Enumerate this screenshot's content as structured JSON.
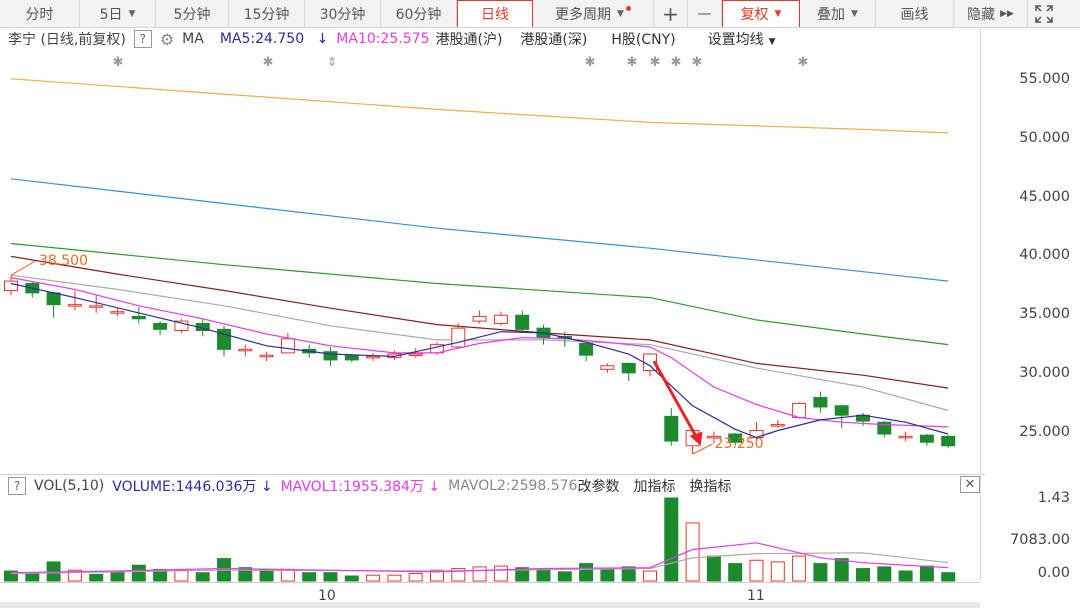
{
  "toolbar": {
    "items": [
      "分时",
      "5日",
      "5分钟",
      "15分钟",
      "30分钟",
      "60分钟",
      "日线",
      "更多周期",
      "+",
      "—",
      "复权",
      "叠加",
      "画线",
      "隐藏"
    ],
    "fullscreen_icon": "expand-icon"
  },
  "info": {
    "stock": "李宁 (日线,前复权)",
    "help": "?",
    "ma_label": "MA",
    "ma5": "MA5:24.750",
    "ma5_arrow": "↓",
    "ma10": "MA10:25.575",
    "hk_sh": "港股通(沪)",
    "hk_sz": "港股通(深)",
    "hshare": "H股(CNY)",
    "set_ma": "设置均线"
  },
  "price_axis": [
    "55.000",
    "50.000",
    "45.000",
    "40.000",
    "35.000",
    "30.000",
    "25.000"
  ],
  "annotations": {
    "high": "38.500",
    "low": "23.250"
  },
  "volume": {
    "help": "?",
    "label": "VOL(5,10)",
    "volume": "VOLUME:1446.036万",
    "vol_arrow": "↓",
    "mavol1": "MAVOL1:1955.384万",
    "mavol1_arrow": "↓",
    "mavol2": "MAVOL2:2598.576",
    "change_params": "改参数",
    "add_indicator": "加指标",
    "switch_indicator": "换指标",
    "close": "✕",
    "axis": [
      "1.43",
      "7083.00",
      "0.00"
    ]
  },
  "dates": [
    "10",
    "11"
  ],
  "colors": {
    "up": "#e8382a",
    "down": "#1e8a2e",
    "ma5": "#2c2c9e",
    "ma10": "#e83ae8",
    "ma20": "#aaaaaa",
    "ma30": "#8b2020",
    "ma60": "#2e9b2e",
    "ma120": "#3a8fd8",
    "ma250": "#f0b040"
  },
  "chart_data": {
    "type": "candlestick",
    "ylim": [
      22.6,
      58
    ],
    "candles": [
      {
        "o": 37.2,
        "c": 38.0,
        "h": 38.5,
        "l": 36.8
      },
      {
        "o": 37.8,
        "c": 37.0,
        "h": 38.0,
        "l": 36.6
      },
      {
        "o": 37.0,
        "c": 36.0,
        "h": 37.1,
        "l": 34.9
      },
      {
        "o": 36.0,
        "c": 36.0,
        "h": 37.2,
        "l": 35.5
      },
      {
        "o": 35.9,
        "c": 35.9,
        "h": 36.8,
        "l": 35.3
      },
      {
        "o": 35.4,
        "c": 35.4,
        "h": 35.7,
        "l": 35.0
      },
      {
        "o": 35.0,
        "c": 34.8,
        "h": 35.8,
        "l": 34.4
      },
      {
        "o": 34.4,
        "c": 33.9,
        "h": 34.6,
        "l": 33.4
      },
      {
        "o": 33.8,
        "c": 34.6,
        "h": 34.8,
        "l": 33.6
      },
      {
        "o": 34.4,
        "c": 33.8,
        "h": 34.8,
        "l": 33.3
      },
      {
        "o": 33.9,
        "c": 32.2,
        "h": 34.2,
        "l": 31.6
      },
      {
        "o": 32.2,
        "c": 32.2,
        "h": 32.6,
        "l": 31.6
      },
      {
        "o": 31.7,
        "c": 31.7,
        "h": 32.0,
        "l": 31.2
      },
      {
        "o": 31.9,
        "c": 33.1,
        "h": 33.6,
        "l": 31.9
      },
      {
        "o": 32.2,
        "c": 31.9,
        "h": 32.6,
        "l": 31.5
      },
      {
        "o": 32.0,
        "c": 31.3,
        "h": 32.4,
        "l": 30.8
      },
      {
        "o": 31.7,
        "c": 31.3,
        "h": 31.8,
        "l": 31.1
      },
      {
        "o": 31.6,
        "c": 31.6,
        "h": 31.9,
        "l": 31.2
      },
      {
        "o": 31.5,
        "c": 31.8,
        "h": 32.1,
        "l": 31.3
      },
      {
        "o": 31.8,
        "c": 31.8,
        "h": 32.3,
        "l": 31.5
      },
      {
        "o": 31.9,
        "c": 32.6,
        "h": 32.8,
        "l": 31.7
      },
      {
        "o": 32.4,
        "c": 34.0,
        "h": 34.4,
        "l": 32.3
      },
      {
        "o": 34.6,
        "c": 35.0,
        "h": 35.5,
        "l": 34.4
      },
      {
        "o": 34.4,
        "c": 35.1,
        "h": 35.4,
        "l": 34.2
      },
      {
        "o": 35.1,
        "c": 33.9,
        "h": 35.5,
        "l": 33.6
      },
      {
        "o": 34.0,
        "c": 33.2,
        "h": 34.3,
        "l": 32.6
      },
      {
        "o": 33.3,
        "c": 33.1,
        "h": 33.7,
        "l": 32.4
      },
      {
        "o": 32.7,
        "c": 31.7,
        "h": 32.8,
        "l": 31.2
      },
      {
        "o": 30.5,
        "c": 30.8,
        "h": 31.0,
        "l": 30.2
      },
      {
        "o": 31.0,
        "c": 30.2,
        "h": 31.1,
        "l": 29.5
      },
      {
        "o": 30.4,
        "c": 31.8,
        "h": 31.9,
        "l": 29.9
      },
      {
        "o": 26.5,
        "c": 24.4,
        "h": 27.2,
        "l": 24.0
      },
      {
        "o": 24.0,
        "c": 25.3,
        "h": 25.4,
        "l": 23.3
      },
      {
        "o": 24.8,
        "c": 24.8,
        "h": 25.2,
        "l": 24.2
      },
      {
        "o": 25.0,
        "c": 24.3,
        "h": 25.1,
        "l": 24.0
      },
      {
        "o": 24.7,
        "c": 25.3,
        "h": 26.0,
        "l": 24.5
      },
      {
        "o": 25.8,
        "c": 25.8,
        "h": 26.2,
        "l": 25.5
      },
      {
        "o": 26.4,
        "c": 27.6,
        "h": 27.7,
        "l": 26.3
      },
      {
        "o": 28.1,
        "c": 27.3,
        "h": 28.6,
        "l": 26.8
      },
      {
        "o": 27.4,
        "c": 26.6,
        "h": 27.5,
        "l": 25.5
      },
      {
        "o": 26.6,
        "c": 26.1,
        "h": 26.8,
        "l": 25.7
      },
      {
        "o": 26.0,
        "c": 25.0,
        "h": 26.1,
        "l": 24.7
      },
      {
        "o": 24.8,
        "c": 24.8,
        "h": 25.2,
        "l": 24.4
      },
      {
        "o": 24.9,
        "c": 24.3,
        "h": 25.0,
        "l": 24.0
      },
      {
        "o": 24.8,
        "c": 24.0,
        "h": 24.9,
        "l": 23.8
      }
    ],
    "ma5": [
      [
        0,
        37.8
      ],
      [
        3,
        36.6
      ],
      [
        6,
        35.3
      ],
      [
        9,
        34.0
      ],
      [
        12,
        32.5
      ],
      [
        15,
        31.8
      ],
      [
        18,
        31.6
      ],
      [
        21,
        32.8
      ],
      [
        23,
        33.7
      ],
      [
        25,
        33.6
      ],
      [
        27,
        32.8
      ],
      [
        29,
        31.8
      ],
      [
        30,
        30.8
      ],
      [
        32,
        27.4
      ],
      [
        34,
        25.4
      ],
      [
        35,
        24.7
      ],
      [
        36,
        25.3
      ],
      [
        38,
        26.2
      ],
      [
        40,
        26.6
      ],
      [
        42,
        26.0
      ],
      [
        44,
        25.0
      ]
    ],
    "ma10": [
      [
        0,
        38.3
      ],
      [
        3,
        37.3
      ],
      [
        6,
        35.9
      ],
      [
        9,
        34.8
      ],
      [
        12,
        33.5
      ],
      [
        15,
        32.5
      ],
      [
        18,
        31.9
      ],
      [
        20,
        31.9
      ],
      [
        22,
        32.7
      ],
      [
        24,
        33.2
      ],
      [
        26,
        33.1
      ],
      [
        28,
        32.8
      ],
      [
        30,
        32.4
      ],
      [
        31,
        31.5
      ],
      [
        33,
        29.0
      ],
      [
        35,
        27.5
      ],
      [
        37,
        26.4
      ],
      [
        39,
        26.0
      ],
      [
        41,
        25.8
      ],
      [
        44,
        25.6
      ]
    ],
    "ma20": [
      [
        0,
        38.5
      ],
      [
        5,
        37.3
      ],
      [
        10,
        35.9
      ],
      [
        15,
        34.2
      ],
      [
        20,
        33.0
      ],
      [
        25,
        33.0
      ],
      [
        30,
        32.6
      ],
      [
        35,
        30.6
      ],
      [
        40,
        29.0
      ],
      [
        44,
        27.0
      ]
    ],
    "ma30": [
      [
        0,
        40.1
      ],
      [
        5,
        38.6
      ],
      [
        10,
        37.2
      ],
      [
        15,
        35.7
      ],
      [
        20,
        34.3
      ],
      [
        25,
        33.6
      ],
      [
        30,
        33.0
      ],
      [
        35,
        31.0
      ],
      [
        40,
        30.0
      ],
      [
        44,
        28.9
      ]
    ],
    "ma60": [
      [
        0,
        41.2
      ],
      [
        10,
        39.4
      ],
      [
        20,
        37.8
      ],
      [
        30,
        36.6
      ],
      [
        35,
        34.7
      ],
      [
        40,
        33.5
      ],
      [
        44,
        32.6
      ]
    ],
    "ma120": [
      [
        0,
        46.7
      ],
      [
        10,
        44.6
      ],
      [
        20,
        42.5
      ],
      [
        30,
        40.8
      ],
      [
        40,
        38.8
      ],
      [
        44,
        38.0
      ]
    ],
    "ma250": [
      [
        0,
        55.2
      ],
      [
        10,
        53.9
      ],
      [
        20,
        52.6
      ],
      [
        30,
        51.5
      ],
      [
        40,
        50.9
      ],
      [
        44,
        50.6
      ]
    ],
    "volume": [
      {
        "v": 0.12,
        "up": false
      },
      {
        "v": 0.1,
        "up": false
      },
      {
        "v": 0.23,
        "up": false
      },
      {
        "v": 0.13,
        "up": true
      },
      {
        "v": 0.08,
        "up": false
      },
      {
        "v": 0.11,
        "up": false
      },
      {
        "v": 0.19,
        "up": false
      },
      {
        "v": 0.14,
        "up": false
      },
      {
        "v": 0.13,
        "up": true
      },
      {
        "v": 0.1,
        "up": false
      },
      {
        "v": 0.27,
        "up": false
      },
      {
        "v": 0.16,
        "up": false
      },
      {
        "v": 0.14,
        "up": false
      },
      {
        "v": 0.14,
        "up": true
      },
      {
        "v": 0.1,
        "up": false
      },
      {
        "v": 0.1,
        "up": false
      },
      {
        "v": 0.06,
        "up": false
      },
      {
        "v": 0.07,
        "up": true
      },
      {
        "v": 0.07,
        "up": true
      },
      {
        "v": 0.09,
        "up": true
      },
      {
        "v": 0.13,
        "up": true
      },
      {
        "v": 0.15,
        "up": true
      },
      {
        "v": 0.17,
        "up": true
      },
      {
        "v": 0.18,
        "up": true
      },
      {
        "v": 0.16,
        "up": false
      },
      {
        "v": 0.14,
        "up": false
      },
      {
        "v": 0.11,
        "up": false
      },
      {
        "v": 0.21,
        "up": false
      },
      {
        "v": 0.15,
        "up": false
      },
      {
        "v": 0.17,
        "up": false
      },
      {
        "v": 0.12,
        "up": true
      },
      {
        "v": 1.0,
        "up": false
      },
      {
        "v": 0.7,
        "up": true
      },
      {
        "v": 0.3,
        "up": false
      },
      {
        "v": 0.21,
        "up": false
      },
      {
        "v": 0.25,
        "up": true
      },
      {
        "v": 0.23,
        "up": true
      },
      {
        "v": 0.3,
        "up": true
      },
      {
        "v": 0.21,
        "up": false
      },
      {
        "v": 0.27,
        "up": false
      },
      {
        "v": 0.15,
        "up": false
      },
      {
        "v": 0.17,
        "up": false
      },
      {
        "v": 0.12,
        "up": false
      },
      {
        "v": 0.18,
        "up": false
      },
      {
        "v": 0.1,
        "up": false
      }
    ],
    "mavol1": [
      [
        0,
        0.1
      ],
      [
        5,
        0.12
      ],
      [
        10,
        0.15
      ],
      [
        15,
        0.13
      ],
      [
        20,
        0.11
      ],
      [
        25,
        0.15
      ],
      [
        30,
        0.16
      ],
      [
        32,
        0.38
      ],
      [
        35,
        0.46
      ],
      [
        36,
        0.4
      ],
      [
        38,
        0.28
      ],
      [
        40,
        0.22
      ],
      [
        44,
        0.16
      ]
    ],
    "mavol2": [
      [
        0,
        0.09
      ],
      [
        10,
        0.13
      ],
      [
        20,
        0.12
      ],
      [
        30,
        0.15
      ],
      [
        32,
        0.28
      ],
      [
        35,
        0.33
      ],
      [
        40,
        0.34
      ],
      [
        44,
        0.22
      ]
    ]
  }
}
